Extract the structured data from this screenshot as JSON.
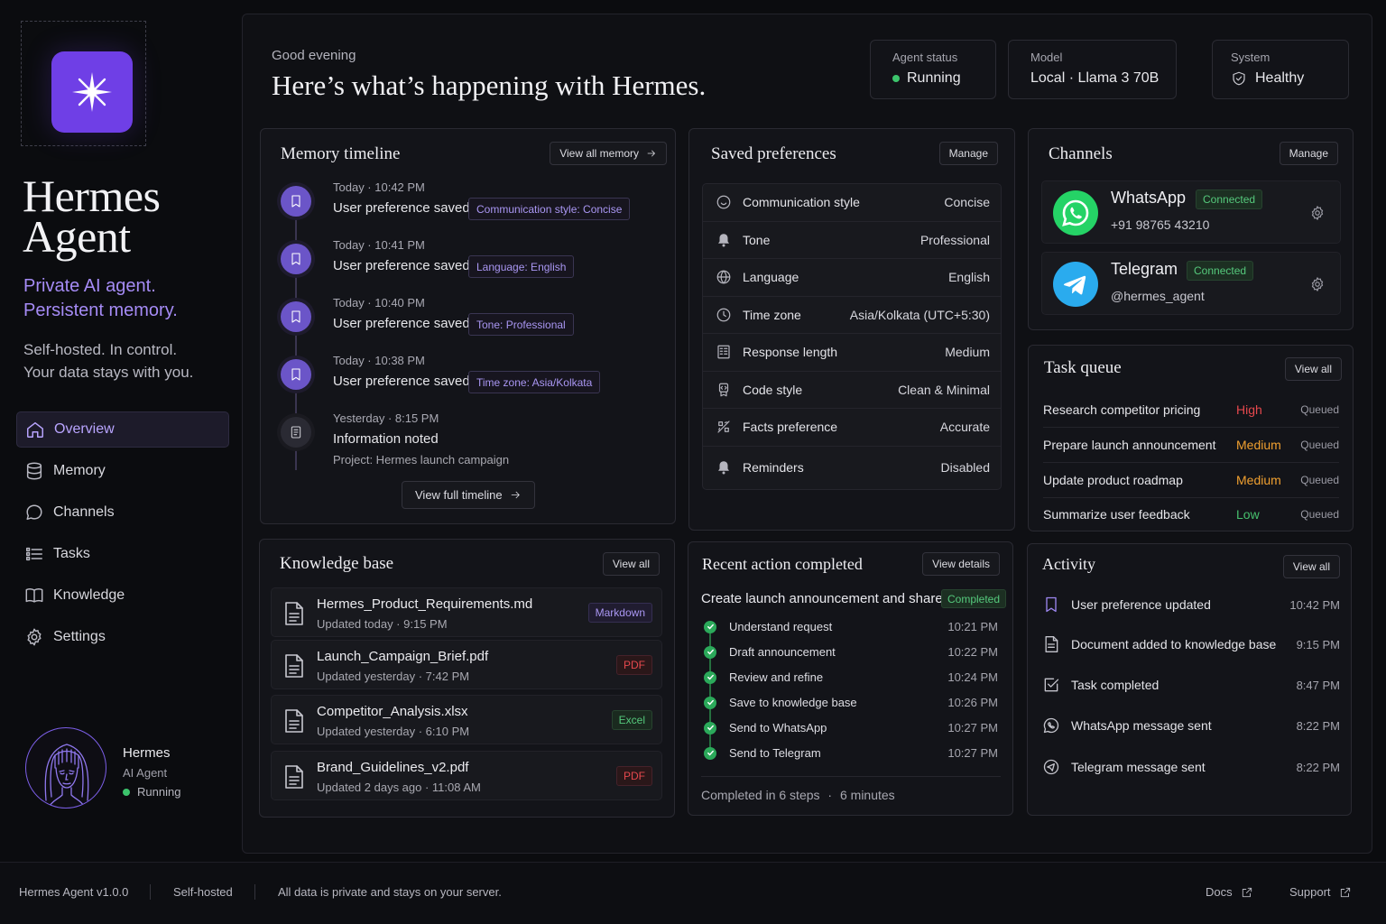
{
  "app": {
    "name": "Hermes\nAgent",
    "tagline": "Private AI agent.\nPersistent memory.",
    "subline": "Self-hosted. In control.\nYour data stays with you.",
    "logo_icon": "sparkle-star-icon",
    "accent": "#6f3fe6"
  },
  "nav": {
    "items": [
      {
        "label": "Overview",
        "icon": "home-icon",
        "active": true
      },
      {
        "label": "Memory",
        "icon": "database-icon"
      },
      {
        "label": "Channels",
        "icon": "chat-bubble-icon"
      },
      {
        "label": "Tasks",
        "icon": "list-check-icon"
      },
      {
        "label": "Knowledge",
        "icon": "book-icon"
      },
      {
        "label": "Settings",
        "icon": "gear-icon"
      }
    ]
  },
  "profile": {
    "name": "Hermes",
    "role": "AI Agent",
    "status": "Running"
  },
  "header": {
    "greeting": "Good evening",
    "headline": "Here’s what’s happening with Hermes.",
    "stats": [
      {
        "label": "Agent status",
        "value": "Running"
      },
      {
        "label": "Model",
        "value": "Local · Llama 3 70B"
      },
      {
        "label": "System",
        "value": "Healthy"
      }
    ]
  },
  "memory": {
    "title": "Memory timeline",
    "button": "View all memory",
    "items": [
      {
        "time": "Today · 10:42 PM",
        "text": "User preference saved",
        "tag": "Communication style: Concise"
      },
      {
        "time": "Today · 10:41 PM",
        "text": "User preference saved",
        "tag": "Language: English"
      },
      {
        "time": "Today · 10:40 PM",
        "text": "User preference saved",
        "tag": "Tone: Professional"
      },
      {
        "time": "Today · 10:38 PM",
        "text": "User preference saved",
        "tag": "Time zone: Asia/Kolkata"
      },
      {
        "time": "Yesterday · 8:15 PM",
        "text": "Information noted",
        "sub": "Project: Hermes launch campaign"
      }
    ],
    "footer_button": "View full timeline"
  },
  "preferences": {
    "title": "Saved preferences",
    "button": "Manage",
    "rows": [
      {
        "key": "Communication style",
        "value": "Concise",
        "icon": "speech-smile-icon"
      },
      {
        "key": "Tone",
        "value": "Professional",
        "icon": "bell-icon"
      },
      {
        "key": "Language",
        "value": "English",
        "icon": "globe-icon"
      },
      {
        "key": "Time zone",
        "value": "Asia/Kolkata (UTC+5:30)",
        "icon": "clock-icon"
      },
      {
        "key": "Response length",
        "value": "Medium",
        "icon": "text-lines-icon"
      },
      {
        "key": "Code style",
        "value": "Clean & Minimal",
        "icon": "code-badge-icon"
      },
      {
        "key": "Facts preference",
        "value": "Accurate",
        "icon": "facts-icon"
      },
      {
        "key": "Reminders",
        "value": "Disabled",
        "icon": "bell-icon"
      }
    ]
  },
  "channels": {
    "title": "Channels",
    "button": "Manage",
    "items": [
      {
        "name": "WhatsApp",
        "status": "Connected",
        "handle": "+91 98765 43210",
        "color": "#25d366"
      },
      {
        "name": "Telegram",
        "status": "Connected",
        "handle": "@hermes_agent",
        "color": "#2aabee"
      }
    ]
  },
  "tasks": {
    "title": "Task queue",
    "button": "View all",
    "items": [
      {
        "name": "Research competitor pricing",
        "priority": "High",
        "status": "Queued",
        "color": "#e5484d"
      },
      {
        "name": "Prepare launch announcement",
        "priority": "Medium",
        "status": "Queued",
        "color": "#f0a030"
      },
      {
        "name": "Update product roadmap",
        "priority": "Medium",
        "status": "Queued",
        "color": "#f0a030"
      },
      {
        "name": "Summarize user feedback",
        "priority": "Low",
        "status": "Queued",
        "color": "#46c06d"
      }
    ]
  },
  "knowledge": {
    "title": "Knowledge base",
    "button": "View all",
    "items": [
      {
        "name": "Hermes_Product_Requirements.md",
        "updated": "Updated today · 9:15 PM",
        "type": "Markdown"
      },
      {
        "name": "Launch_Campaign_Brief.pdf",
        "updated": "Updated yesterday · 7:42 PM",
        "type": "PDF"
      },
      {
        "name": "Competitor_Analysis.xlsx",
        "updated": "Updated yesterday · 6:10 PM",
        "type": "Excel"
      },
      {
        "name": "Brand_Guidelines_v2.pdf",
        "updated": "Updated 2 days ago · 11:08 AM",
        "type": "PDF"
      }
    ]
  },
  "recent": {
    "title": "Recent action completed",
    "button": "View details",
    "task": "Create launch announcement and share",
    "status": "Completed",
    "steps": [
      {
        "name": "Understand request",
        "time": "10:21 PM"
      },
      {
        "name": "Draft announcement",
        "time": "10:22 PM"
      },
      {
        "name": "Review and refine",
        "time": "10:24 PM"
      },
      {
        "name": "Save to knowledge base",
        "time": "10:26 PM"
      },
      {
        "name": "Send to WhatsApp",
        "time": "10:27 PM"
      },
      {
        "name": "Send to Telegram",
        "time": "10:27 PM"
      }
    ],
    "summary_steps": "Completed in 6 steps",
    "summary_sep": "·",
    "summary_time": "6 minutes"
  },
  "activity": {
    "title": "Activity",
    "button": "View all",
    "items": [
      {
        "text": "User preference updated",
        "time": "10:42 PM",
        "icon": "bookmark-icon"
      },
      {
        "text": "Document added to knowledge base",
        "time": "9:15 PM",
        "icon": "document-icon"
      },
      {
        "text": "Task completed",
        "time": "8:47 PM",
        "icon": "checkbox-icon"
      },
      {
        "text": "WhatsApp message sent",
        "time": "8:22 PM",
        "icon": "whatsapp-icon"
      },
      {
        "text": "Telegram message sent",
        "time": "8:22 PM",
        "icon": "send-icon"
      }
    ]
  },
  "footer": {
    "version": "Hermes Agent v1.0.0",
    "hosting": "Self-hosted",
    "privacy": "All data is private and stays on your server.",
    "docs": "Docs",
    "support": "Support"
  }
}
